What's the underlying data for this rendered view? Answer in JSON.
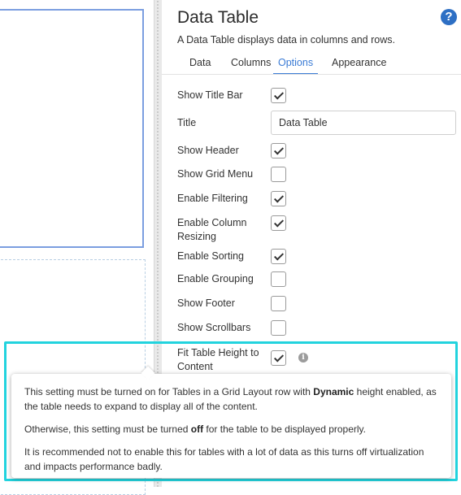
{
  "panel": {
    "title": "Data Table",
    "description": "A Data Table displays data in columns and rows.",
    "help_icon": "question-circle-icon",
    "help_glyph": "?"
  },
  "tabs": [
    {
      "label": "Data",
      "active": false
    },
    {
      "label": "Columns",
      "active": false
    },
    {
      "label": "Options",
      "active": true
    },
    {
      "label": "Appearance",
      "active": false
    }
  ],
  "options": {
    "show_title_bar": {
      "label": "Show Title Bar",
      "checked": true
    },
    "title": {
      "label": "Title",
      "value": "Data Table"
    },
    "show_header": {
      "label": "Show Header",
      "checked": true
    },
    "show_grid_menu": {
      "label": "Show Grid Menu",
      "checked": false
    },
    "enable_filtering": {
      "label": "Enable Filtering",
      "checked": true
    },
    "enable_column_resizing": {
      "label_line1": "Enable Column",
      "label_line2": "Resizing",
      "checked": true
    },
    "enable_sorting": {
      "label": "Enable Sorting",
      "checked": true
    },
    "enable_grouping": {
      "label": "Enable Grouping",
      "checked": false
    },
    "show_footer": {
      "label": "Show Footer",
      "checked": false
    },
    "show_scrollbars": {
      "label": "Show Scrollbars",
      "checked": false
    },
    "fit_table_height": {
      "label_line1": "Fit Table Height to",
      "label_line2": "Content",
      "checked": true,
      "info_glyph": "i"
    }
  },
  "tooltip": {
    "p1_a": "This setting must be turned on for Tables in a Grid Layout row with ",
    "p1_b": "Dynamic",
    "p1_c": " height enabled, as the table needs to expand to display all of the content.",
    "p2_a": "Otherwise, this setting must be turned ",
    "p2_b": "off",
    "p2_c": " for the table to be displayed properly.",
    "p3": "It is recommended not to enable this for tables with a lot of data as this turns off virtualization and impacts performance badly."
  },
  "colors": {
    "accent": "#3a7bd5",
    "highlight": "#22d3de",
    "selected_widget_border": "#7b9ee0"
  }
}
